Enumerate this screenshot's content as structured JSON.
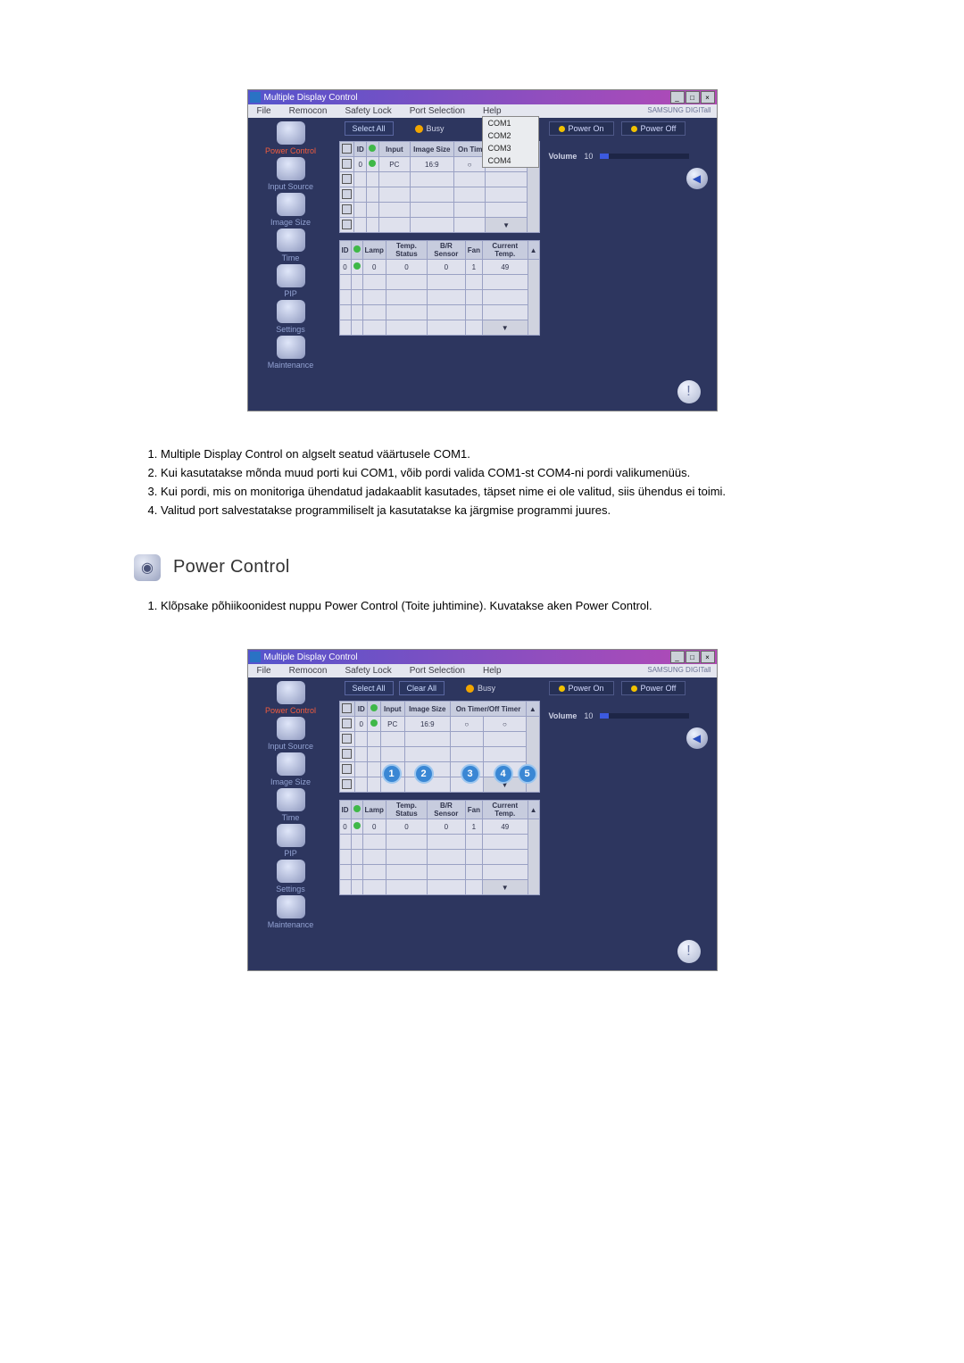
{
  "app_title": "Multiple Display Control",
  "menu": [
    "File",
    "Remocon",
    "Safety Lock",
    "Port Selection",
    "Help"
  ],
  "branding": "SAMSUNG DIGITall",
  "buttons": {
    "select_all": "Select All",
    "clear_all": "Clear All",
    "busy": "Busy",
    "power_on": "Power On",
    "power_off": "Power Off",
    "volume_label": "Volume",
    "volume_value": "10"
  },
  "port_dropdown": [
    "COM1",
    "COM2",
    "COM3",
    "COM4"
  ],
  "sidebar": {
    "items": [
      {
        "label": "Power Control",
        "active": true
      },
      {
        "label": "Input Source"
      },
      {
        "label": "Image Size"
      },
      {
        "label": "Time"
      },
      {
        "label": "PIP"
      },
      {
        "label": "Settings"
      },
      {
        "label": "Maintenance"
      }
    ]
  },
  "table1": {
    "headers": [
      "✓",
      "ID",
      "●",
      "Input",
      "Image Size",
      "On Timer/Off Timer"
    ],
    "row": [
      "",
      "0",
      "●",
      "PC",
      "16:9",
      "○",
      "○"
    ]
  },
  "table2": {
    "headers": [
      "ID",
      "●",
      "Lamp",
      "Temp. Status",
      "B/R Sensor",
      "Fan",
      "Current Temp."
    ],
    "row": [
      "0",
      "●",
      "0",
      "0",
      "0",
      "1",
      "49"
    ]
  },
  "callouts": [
    "1",
    "2",
    "3",
    "4",
    "5"
  ],
  "notes": [
    {
      "n": "1.",
      "t": "Multiple Display Control on algselt seatud väärtusele COM1."
    },
    {
      "n": "2.",
      "t": "Kui kasutatakse mõnda muud porti kui COM1, võib pordi valida COM1-st COM4-ni pordi valikumenüüs."
    },
    {
      "n": "3.",
      "t": "Kui pordi, mis on monitoriga ühendatud jadakaablit kasutades, täpset nime ei ole valitud, siis ühendus ei toimi."
    },
    {
      "n": "4.",
      "t": "Valitud port salvestatakse programmiliselt ja kasutatakse ka järgmise programmi juures."
    }
  ],
  "section_title": "Power Control",
  "section_notes": [
    {
      "n": "1.",
      "t": "Klõpsake põhiikoonidest nuppu Power Control (Toite juhtimine). Kuvatakse aken Power Control."
    }
  ]
}
